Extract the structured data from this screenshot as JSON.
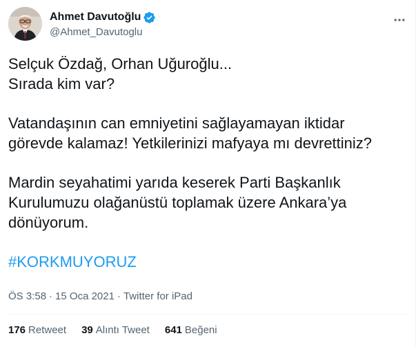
{
  "author": {
    "display_name": "Ahmet Davutoğlu",
    "handle": "@Ahmet_Davutoglu",
    "verified": true,
    "verified_color": "#1d9bf0"
  },
  "icons": {
    "verified": "verified-badge-icon",
    "more": "more-options-icon"
  },
  "tweet": {
    "paragraphs": [
      [
        "Selçuk Özdağ, Orhan Uğuroğlu...",
        "Sırada kim var?"
      ],
      [
        "Vatandaşının can emniyetini sağlayamayan iktidar",
        "görevde kalamaz! Yetkilerinizi mafyaya mı devrettiniz?"
      ],
      [
        "Mardin seyahatimi yarıda keserek Parti Başkanlık",
        "Kurulumuzu olağanüstü toplamak üzere Ankara’ya",
        "dönüyorum."
      ]
    ],
    "hashtag": "#KORKMUYORUZ",
    "hashtag_color": "#1d9bf0"
  },
  "meta": {
    "time": "ÖS 3:58",
    "date": "15 Oca 2021",
    "source": "Twitter for iPad",
    "separator": "·"
  },
  "stats": {
    "retweets": {
      "count": "176",
      "label": "Retweet"
    },
    "quotes": {
      "count": "39",
      "label": "Alıntı Tweet"
    },
    "likes": {
      "count": "641",
      "label": "Beğeni"
    }
  }
}
